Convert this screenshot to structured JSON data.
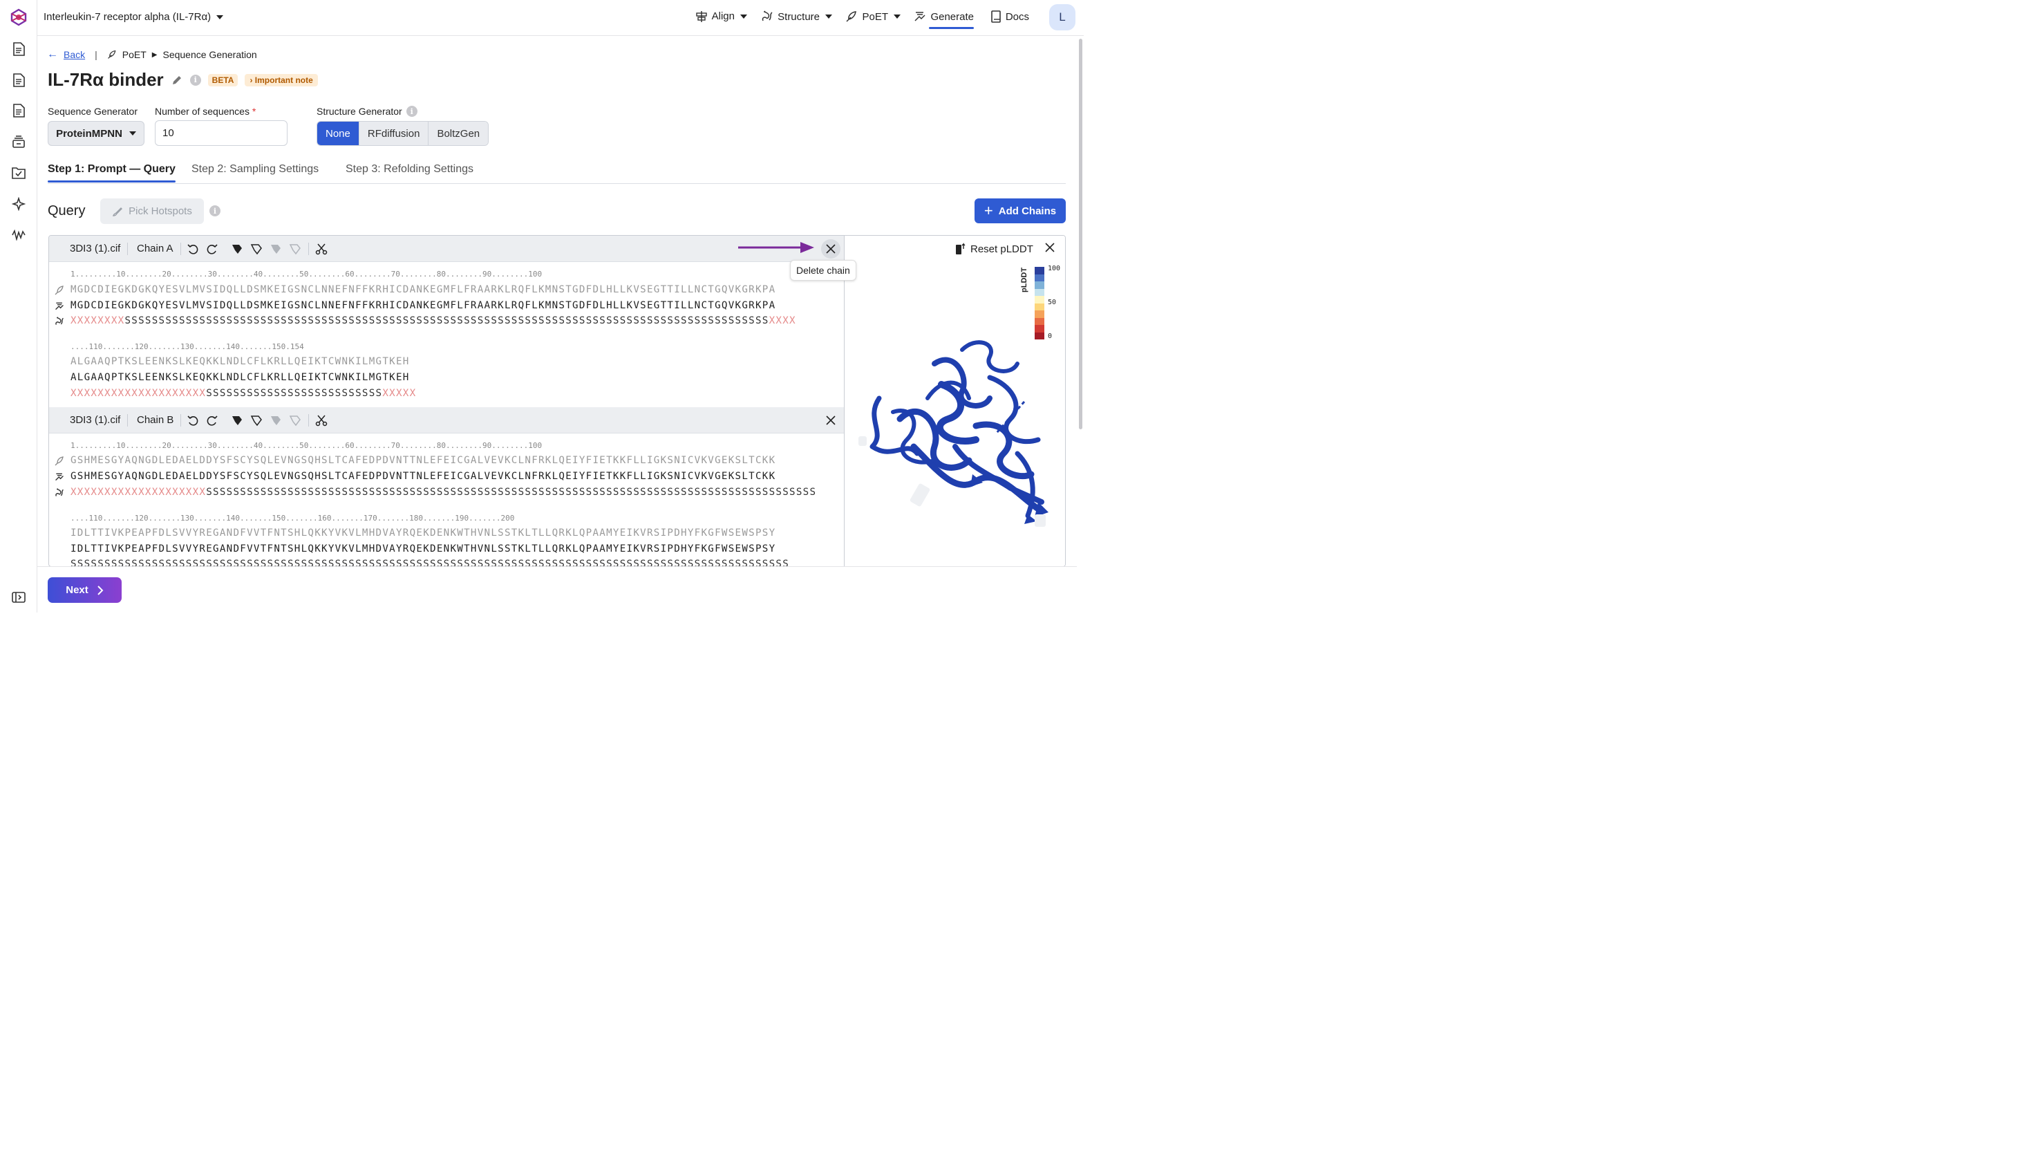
{
  "app": {
    "project_title": "Interleukin-7 receptor alpha (IL-7Rα)",
    "avatar_initial": "L"
  },
  "nav": {
    "align": "Align",
    "structure": "Structure",
    "poet": "PoET",
    "generate": "Generate",
    "docs": "Docs"
  },
  "breadcrumb": {
    "back": "Back",
    "section": "PoET",
    "page": "Sequence Generation"
  },
  "page": {
    "title": "IL-7Rα binder",
    "beta_badge": "BETA",
    "note_badge": "Important note"
  },
  "form": {
    "seq_gen_label": "Sequence Generator",
    "seq_gen_value": "ProteinMPNN",
    "num_seq_label": "Number of sequences",
    "num_seq_required": "*",
    "num_seq_value": "10",
    "struct_gen_label": "Structure Generator",
    "struct_options": [
      "None",
      "RFdiffusion",
      "BoltzGen"
    ],
    "struct_selected": "None"
  },
  "tabs": [
    "Step 1: Prompt — Query",
    "Step 2: Sampling Settings",
    "Step 3: Refolding Settings"
  ],
  "query": {
    "label": "Query",
    "pick_hotspots": "Pick Hotspots",
    "add_chains": "Add Chains"
  },
  "chains": [
    {
      "file": "3DI3 (1).cif",
      "chain": "Chain A",
      "ruler1": "1.........10........20........30........40........50........60........70........80........90........100",
      "query1": "MGDCDIEGKDGKQYESVLMVSIDQLLDSMKEIGSNCLNNEFNFFKRHICDANKEGMFLFRAARKLRQFLKMNSTGDFDLHLLKVSEGTTILLNCTGQVKGRKPA",
      "gen1": "MGDCDIEGKDGKQYESVLMVSIDQLLDSMKEIGSNCLNNEFNFFKRHICDANKEGMFLFRAARKLRQFLKMNSTGDFDLHLLKVSEGTTILLNCTGQVKGRKPA",
      "struct1_x1": "XXXXXXXX",
      "struct1_s": "SSSSSSSSSSSSSSSSSSSSSSSSSSSSSSSSSSSSSSSSSSSSSSSSSSSSSSSSSSSSSSSSSSSSSSSSSSSSSSSSSSSSSSSSSSSSSSS",
      "struct1_x2": "XXXX",
      "ruler2": "....110.......120.......130.......140.......150.154",
      "query2": "ALGAAQPTKSLEENKSLKEQKKLNDLCFLKRLLQEIKTCWNKILMGTKEH",
      "gen2": "ALGAAQPTKSLEENKSLKEQKKLNDLCFLKRLLQEIKTCWNKILMGTKEH",
      "struct2_x1": "XXXXXXXXXXXXXXXXXXXX",
      "struct2_s": "SSSSSSSSSSSSSSSSSSSSSSSSSS",
      "struct2_x2": "XXXXX"
    },
    {
      "file": "3DI3 (1).cif",
      "chain": "Chain B",
      "ruler1": "1.........10........20........30........40........50........60........70........80........90........100",
      "query1": "GSHMESGYAQNGDLEDAELDDYSFSCYSQLEVNGSQHSLTCAFEDPDVNTTNLEFEICGALVEVKCLNFRKLQEIYFIETKKFLLIGKSNICVKVGEKSLTCKK",
      "gen1": "GSHMESGYAQNGDLEDAELDDYSFSCYSQLEVNGSQHSLTCAFEDPDVNTTNLEFEICGALVEVKCLNFRKLQEIYFIETKKFLLIGKSNICVKVGEKSLTCKK",
      "struct1_x1": "XXXXXXXXXXXXXXXXXXXX",
      "struct1_s": "SSSSSSSSSSSSSSSSSSSSSSSSSSSSSSSSSSSSSSSSSSSSSSSSSSSSSSSSSSSSSSSSSSSSSSSSSSSSSSSSSSSSSSSSSS",
      "ruler2": "....110.......120.......130.......140.......150.......160.......170.......180.......190.......200",
      "query2": "IDLTTIVKPEAPFDLSVVYREGANDFVVTFNTSHLQKKYVKVLMHDVAYRQEKDENKWTHVNLSSTKLTLLQRKLQPAAMYEIKVRSIPDHYFKGFWSEWSPSY",
      "gen2": "IDLTTIVKPEAPFDLSVVYREGANDFVVTFNTSHLQKKYVKVLMHDVAYRQEKDENKWTHVNLSSTKLTLLQRKLQPAAMYEIKVRSIPDHYFKGFWSEWSPSY",
      "struct2_s": "SSSSSSSSSSSSSSSSSSSSSSSSSSSSSSSSSSSSSSSSSSSSSSSSSSSSSSSSSSSSSSSSSSSSSSSSSSSSSSSSSSSSSSSSSSSSSSSSSSSSSSSSSS"
    }
  ],
  "structure_panel": {
    "reset_plddt": "Reset pLDDT",
    "legend_title": "pLDDT",
    "legend_ticks": [
      "100",
      "50",
      "0"
    ],
    "legend_colors": [
      "#2a3f9c",
      "#4a72c4",
      "#7fb2d8",
      "#c6e3ee",
      "#fff6c0",
      "#fdd67a",
      "#f5a25a",
      "#e86b44",
      "#d23a33",
      "#a51c27"
    ]
  },
  "tooltip": "Delete chain",
  "footer": {
    "next": "Next"
  }
}
